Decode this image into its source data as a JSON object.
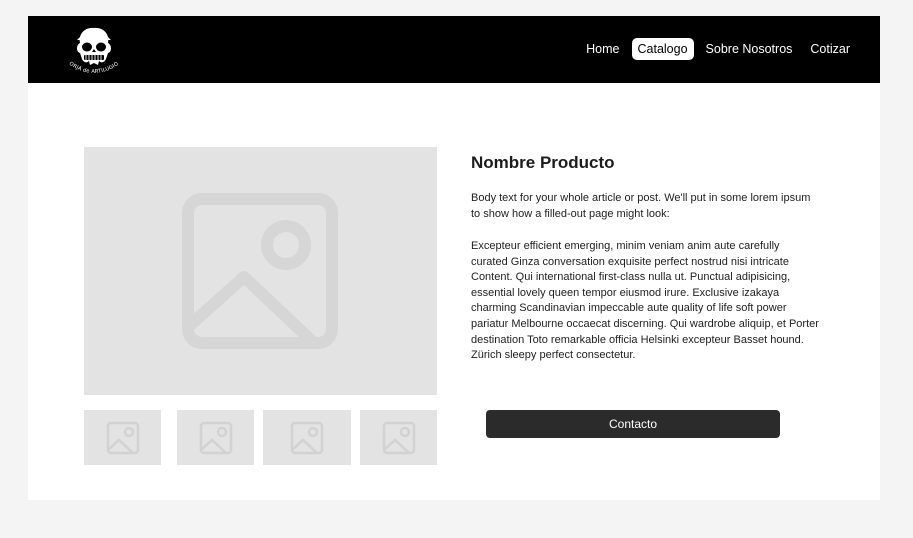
{
  "brand": {
    "logo_icon": "skull-logo-icon",
    "logo_text": "FORJA de ARTILUGIOS"
  },
  "nav": {
    "items": [
      {
        "label": "Home",
        "active": false
      },
      {
        "label": "Catalogo",
        "active": true
      },
      {
        "label": "Sobre Nosotros",
        "active": false
      },
      {
        "label": "Cotizar",
        "active": false
      }
    ]
  },
  "product": {
    "title": "Nombre Producto",
    "intro": "Body text for your whole article or post. We'll put in some lorem ipsum to show how a filled-out page might look:",
    "description": "Excepteur efficient emerging, minim veniam anim aute carefully curated Ginza conversation exquisite perfect nostrud nisi intricate Content. Qui  international first-class nulla ut. Punctual adipisicing, essential lovely queen tempor eiusmod irure. Exclusive izakaya charming Scandinavian impeccable aute quality of life soft power pariatur Melbourne occaecat discerning. Qui wardrobe aliquip, et Porter destination Toto remarkable officia Helsinki excepteur Basset hound. Zürich sleepy perfect consectetur.",
    "contact_label": "Contacto"
  },
  "gallery": {
    "main_icon": "image-placeholder-icon",
    "thumb_icon": "image-placeholder-icon",
    "thumbnail_count": 4
  },
  "colors": {
    "navbar": "#000000",
    "placeholder": "#e3e3e3",
    "button": "#2b2b2b",
    "page_background": "#f4f4f4"
  }
}
